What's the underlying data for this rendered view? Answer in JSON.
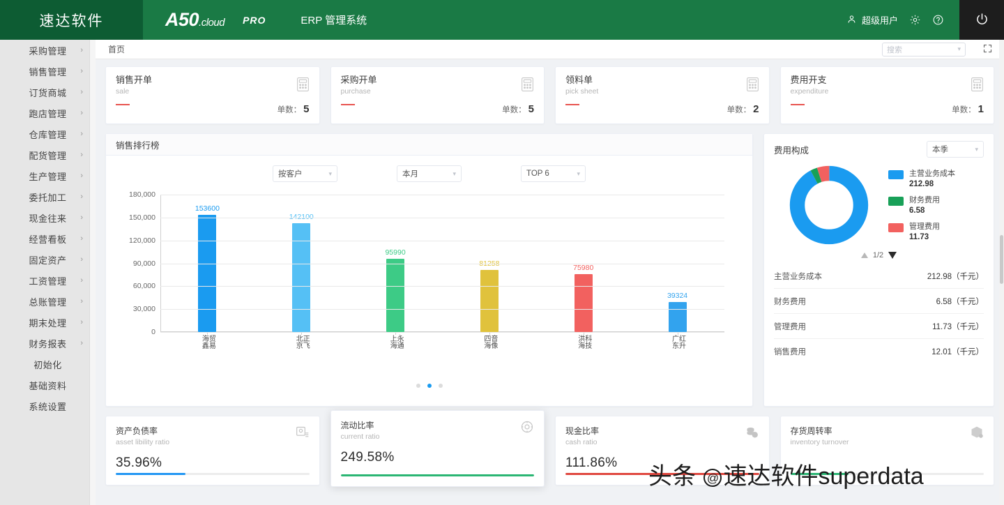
{
  "header": {
    "brand": "速达软件",
    "logo_main": "A50",
    "logo_suffix": ".cloud",
    "logo_pro": "PRO",
    "system_name": "ERP 管理系统",
    "user_name": "超级用户",
    "user_icon": "user-icon",
    "settings_icon": "gear-icon",
    "help_icon": "question-circle-icon",
    "power_icon": "power-icon"
  },
  "sidebar": {
    "items": [
      {
        "label": "采购管理",
        "has_chevron": true
      },
      {
        "label": "销售管理",
        "has_chevron": true
      },
      {
        "label": "订货商城",
        "has_chevron": true
      },
      {
        "label": "跑店管理",
        "has_chevron": true
      },
      {
        "label": "仓库管理",
        "has_chevron": true
      },
      {
        "label": "配货管理",
        "has_chevron": true
      },
      {
        "label": "生产管理",
        "has_chevron": true
      },
      {
        "label": "委托加工",
        "has_chevron": true
      },
      {
        "label": "现金往来",
        "has_chevron": true
      },
      {
        "label": "经营看板",
        "has_chevron": true
      },
      {
        "label": "固定资产",
        "has_chevron": true
      },
      {
        "label": "工资管理",
        "has_chevron": true
      },
      {
        "label": "总账管理",
        "has_chevron": true
      },
      {
        "label": "期末处理",
        "has_chevron": true
      },
      {
        "label": "财务报表",
        "has_chevron": true
      },
      {
        "label": "初始化",
        "has_chevron": false
      },
      {
        "label": "基础资料",
        "has_chevron": false
      },
      {
        "label": "系统设置",
        "has_chevron": false
      }
    ]
  },
  "crumb": {
    "home": "首页",
    "search_placeholder": "搜索",
    "fullscreen_icon": "fullscreen-icon"
  },
  "stat_cards": [
    {
      "title": "销售开单",
      "sub": "sale",
      "count_label": "单数：",
      "count": "5",
      "icon": "calculator-icon"
    },
    {
      "title": "采购开单",
      "sub": "purchase",
      "count_label": "单数：",
      "count": "5",
      "icon": "calculator-icon"
    },
    {
      "title": "领料单",
      "sub": "pick sheet",
      "count_label": "单数：",
      "count": "2",
      "icon": "calculator-icon"
    },
    {
      "title": "费用开支",
      "sub": "expenditure",
      "count_label": "单数：",
      "count": "1",
      "icon": "calculator-icon"
    }
  ],
  "sales_panel": {
    "title": "销售排行榜",
    "filters": [
      {
        "value": "按客户"
      },
      {
        "value": "本月"
      },
      {
        "value": "TOP 6"
      }
    ],
    "carousel": {
      "total": 3,
      "active_index": 1
    }
  },
  "chart_data": {
    "type": "bar",
    "title": "销售排行榜",
    "xlabel": "",
    "ylabel": "",
    "ylim": [
      0,
      180000
    ],
    "yticks": [
      0,
      30000,
      60000,
      90000,
      120000,
      150000,
      180000
    ],
    "ytick_labels": [
      "0",
      "30,000",
      "60,000",
      "90,000",
      "120,000",
      "150,000",
      "180,000"
    ],
    "grid": true,
    "legend": "none",
    "categories": [
      "海鑫贸易",
      "北京正飞",
      "上海永通",
      "四海音像",
      "洪海科技",
      "广东红升"
    ],
    "values": [
      153600,
      142100,
      95990,
      81258,
      75980,
      39324
    ],
    "colors": [
      "#1a9bf0",
      "#55c0f5",
      "#3dcb86",
      "#e0c23c",
      "#f2615f",
      "#32a3ee"
    ]
  },
  "expense_panel": {
    "title": "费用构成",
    "period": "本季",
    "pager": "1/2",
    "unit": "（千元）",
    "legend": [
      {
        "name": "主营业务成本",
        "value": "212.98",
        "color": "#1a9bf0"
      },
      {
        "name": "财务费用",
        "value": "6.58",
        "color": "#18a058"
      },
      {
        "name": "管理费用",
        "value": "11.73",
        "color": "#f2615f"
      }
    ],
    "rows": [
      {
        "name": "主营业务成本",
        "value": "212.98（千元）"
      },
      {
        "name": "财务费用",
        "value": "6.58（千元）"
      },
      {
        "name": "管理费用",
        "value": "11.73（千元）"
      },
      {
        "name": "销售费用",
        "value": "12.01（千元）"
      }
    ],
    "donut": {
      "type": "pie",
      "values": [
        212.98,
        6.58,
        11.73
      ],
      "labels": [
        "主营业务成本",
        "财务费用",
        "管理费用"
      ],
      "colors": [
        "#1a9bf0",
        "#18a058",
        "#f2615f"
      ]
    }
  },
  "bottom_cards": [
    {
      "title": "资产负债率",
      "sub": "asset libility ratio",
      "value": "35.96%",
      "icon": "report-icon",
      "fill_pct": 36,
      "fill_color": "#2196f3"
    },
    {
      "title": "流动比率",
      "sub": "current ratio",
      "value": "249.58%",
      "icon": "gauge-icon",
      "fill_pct": 100,
      "fill_color": "#2bb673"
    },
    {
      "title": "现金比率",
      "sub": "cash ratio",
      "value": "111.86%",
      "icon": "coins-icon",
      "fill_pct": 100,
      "fill_color": "#e0473f"
    },
    {
      "title": "存货周转率",
      "sub": "inventory turnover",
      "value": "",
      "icon": "box-icon",
      "fill_pct": 30,
      "fill_color": "#2bb673"
    }
  ],
  "watermark": {
    "prefix": "头条 ",
    "at": "@",
    "suffix": "速达软件superdata"
  }
}
